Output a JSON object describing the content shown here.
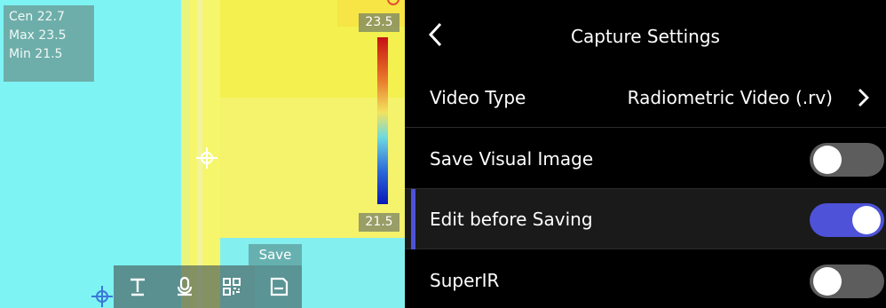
{
  "thermal": {
    "readout": {
      "center": "Cen  22.7",
      "max": "Max  23.5",
      "min": "Min  21.5"
    },
    "scale": {
      "max_label": "23.5",
      "min_label": "21.5"
    },
    "toolbar": {
      "save_label": "Save",
      "tools": [
        "text-icon",
        "microphone-icon",
        "qr-code-icon",
        "save-icon"
      ]
    }
  },
  "settings": {
    "title": "Capture Settings",
    "rows": [
      {
        "label": "Video Type",
        "value": "Radiometric Video (.rv)"
      },
      {
        "label": "Save Visual Image",
        "toggle": false
      },
      {
        "label": "Edit before Saving",
        "toggle": true
      },
      {
        "label": "SuperIR",
        "toggle": false
      }
    ]
  },
  "colors": {
    "accent": "#4d52d8",
    "toggle_off": "#5d5d5d"
  }
}
